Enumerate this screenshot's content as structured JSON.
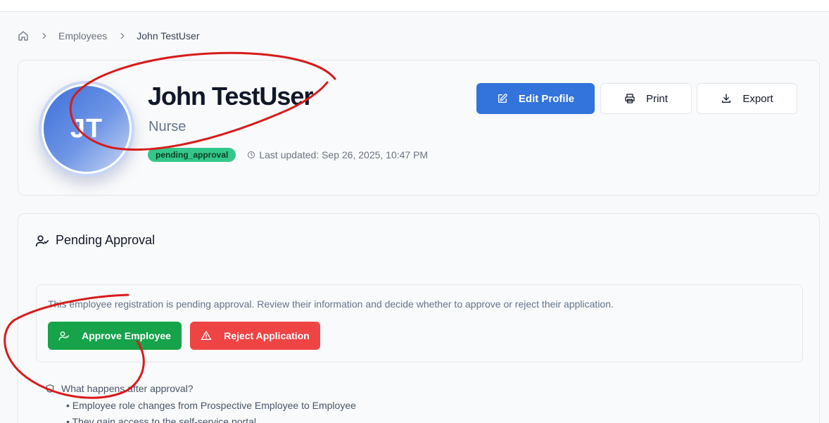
{
  "breadcrumb": {
    "home_icon": "home-icon",
    "separator_icon": "chevron-right-icon",
    "items": [
      {
        "label": "Employees"
      },
      {
        "label": "John TestUser"
      }
    ]
  },
  "profile": {
    "initials": "JT",
    "name": "John TestUser",
    "role": "Nurse",
    "status": "pending_approval",
    "status_color": "#34c78a",
    "last_updated": "Last updated: Sep 26, 2025, 10:47 PM",
    "actions": {
      "edit_label": "Edit Profile",
      "print_label": "Print",
      "export_label": "Export"
    }
  },
  "approval": {
    "title": "Pending Approval",
    "notice_text": "This employee registration is pending approval. Review their information and decide whether to approve or reject their application.",
    "approve_label": "Approve Employee",
    "reject_label": "Reject Application",
    "after_title": "What happens after approval?",
    "after_items": [
      "Employee role changes from Prospective Employee to Employee",
      "They gain access to the self-service portal"
    ]
  },
  "colors": {
    "primary": "#3273dc",
    "success": "#16a34a",
    "danger": "#ef4444",
    "annotation": "#d81b1b"
  }
}
